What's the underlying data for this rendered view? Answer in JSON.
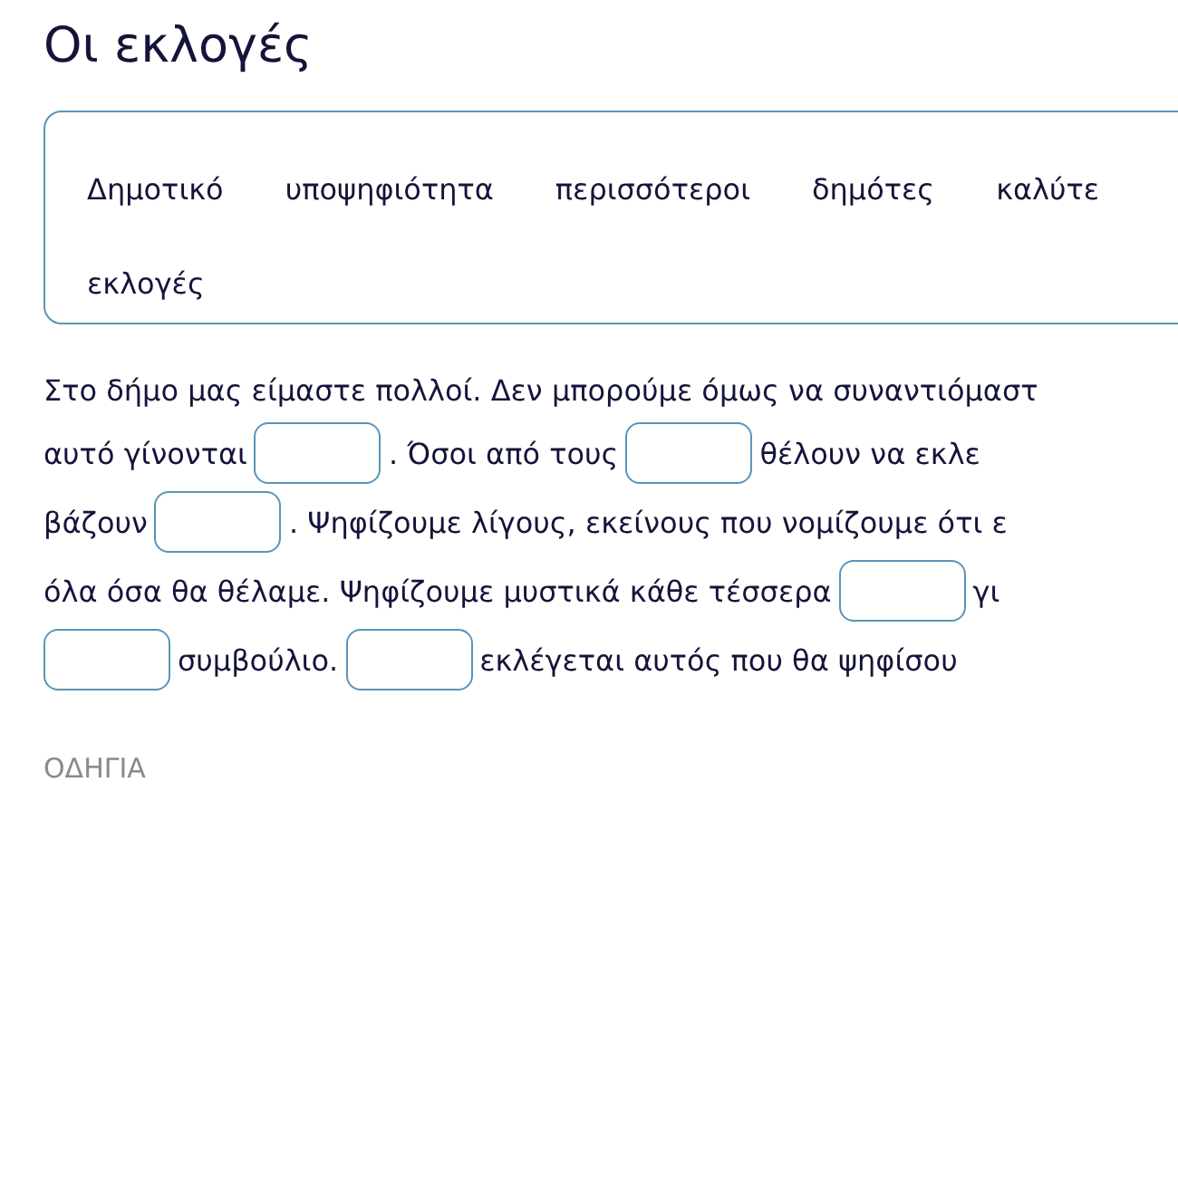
{
  "title": "Οι εκλογές",
  "word_bank": [
    "Δημοτικό",
    "υποψηφιότητα",
    "περισσότεροι",
    "δημότες",
    "καλύτε",
    "εκλογές"
  ],
  "passage": [
    [
      {
        "kind": "text",
        "text": "Στο δήμο μας είμαστε πολλοί. Δεν μπορούμε όμως να συναντιόμαστ"
      }
    ],
    [
      {
        "kind": "text",
        "text": "αυτό γίνονται"
      },
      {
        "kind": "blank"
      },
      {
        "kind": "text",
        "text": ". Όσοι από τους"
      },
      {
        "kind": "blank"
      },
      {
        "kind": "text",
        "text": "θέλουν να εκλε"
      }
    ],
    [
      {
        "kind": "text",
        "text": "βάζουν"
      },
      {
        "kind": "blank"
      },
      {
        "kind": "text",
        "text": ". Ψηφίζουμε λίγους, εκείνους που νομίζουμε ότι ε"
      }
    ],
    [
      {
        "kind": "text",
        "text": "όλα όσα θα θέλαμε. Ψηφίζουμε μυστικά κάθε τέσσερα"
      },
      {
        "kind": "blank"
      },
      {
        "kind": "text",
        "text": "γι"
      }
    ],
    [
      {
        "kind": "blank"
      },
      {
        "kind": "text",
        "text": "συμβούλιο."
      },
      {
        "kind": "blank"
      },
      {
        "kind": "text",
        "text": "εκλέγεται αυτός που θα ψηφίσου"
      }
    ]
  ],
  "instructions_label": "ΟΔΗΓΙΑ"
}
